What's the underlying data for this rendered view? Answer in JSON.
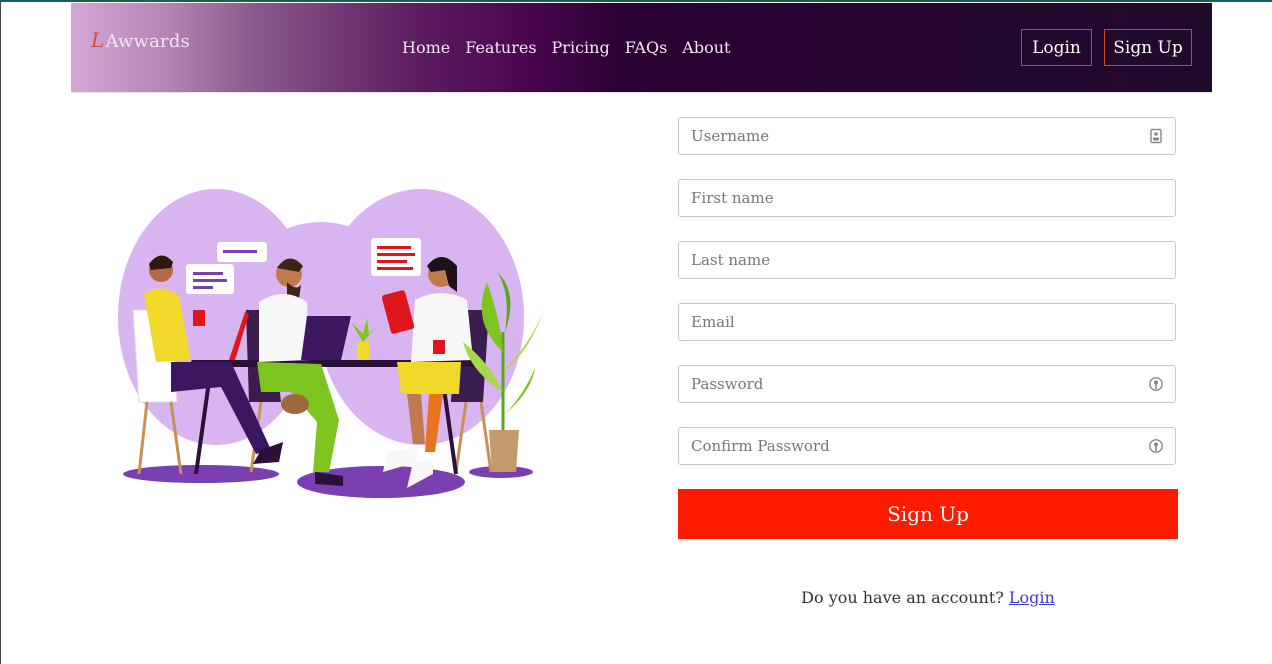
{
  "brand": {
    "logo_letter": "L",
    "name": "Awwards"
  },
  "nav": {
    "links": [
      {
        "label": "Home"
      },
      {
        "label": "Features"
      },
      {
        "label": "Pricing"
      },
      {
        "label": "FAQs"
      },
      {
        "label": "About"
      }
    ],
    "login_label": "Login",
    "signup_label": "Sign Up"
  },
  "form": {
    "username_placeholder": "Username",
    "firstname_placeholder": "First name",
    "lastname_placeholder": "Last name",
    "email_placeholder": "Email",
    "password_placeholder": "Password",
    "confirm_password_placeholder": "Confirm Password",
    "submit_label": "Sign Up",
    "username_icon": "id-card-icon",
    "password_icon": "key-icon"
  },
  "footer": {
    "account_text": "Do you have an account?",
    "login_link": "Login"
  },
  "colors": {
    "accent": "#ff1a00",
    "nav_border": "#d2441e",
    "blob": "#d8b4f0"
  }
}
